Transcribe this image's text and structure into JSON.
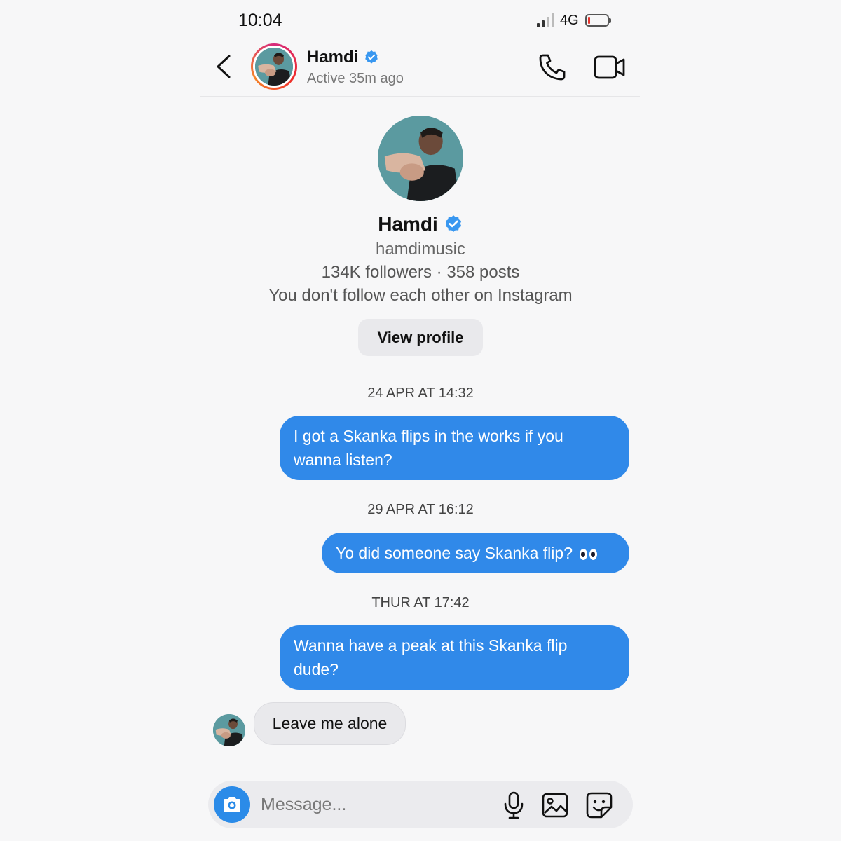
{
  "status_bar": {
    "time": "10:04",
    "network": "4G"
  },
  "header": {
    "name": "Hamdi",
    "status": "Active 35m ago"
  },
  "profile": {
    "name": "Hamdi",
    "username": "hamdimusic",
    "stats": "134K followers · 358 posts",
    "follow_note": "You don't follow each other on Instagram",
    "view_profile_label": "View profile"
  },
  "conversation": {
    "timestamps": [
      "24 APR AT 14:32",
      "29 APR AT 16:12",
      "THUR AT 17:42"
    ],
    "sent": [
      {
        "line1": "I got a Skanka flips in the works if you",
        "line2": "wanna listen?"
      },
      {
        "text": "Yo did someone say Skanka flip?",
        "emoji": "eyes-emoji"
      },
      {
        "line1": "Wanna have a peak at this Skanka flip",
        "line2": "dude?"
      }
    ],
    "received": [
      {
        "text": "Leave me alone"
      }
    ]
  },
  "composer": {
    "placeholder": "Message..."
  },
  "colors": {
    "accent": "#3089e9",
    "verified": "#3897f0",
    "received_bubble": "#e9e9ec"
  }
}
